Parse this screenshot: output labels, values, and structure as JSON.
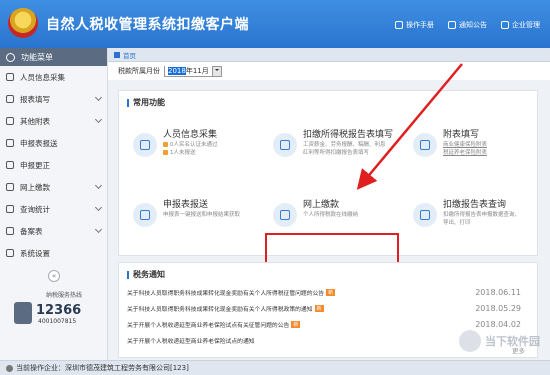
{
  "app": {
    "title": "自然人税收管理系统扣缴客户端",
    "top_links": [
      "操作手册",
      "通知公告",
      "企业管理"
    ]
  },
  "sidebar": {
    "header": "功能菜单",
    "items": [
      {
        "label": "人员信息采集",
        "icon": "person-icon",
        "expandable": false
      },
      {
        "label": "报表填写",
        "icon": "form-icon",
        "expandable": true
      },
      {
        "label": "其他附表",
        "icon": "grid-icon",
        "expandable": true
      },
      {
        "label": "申报表报送",
        "icon": "upload-icon",
        "expandable": false
      },
      {
        "label": "申报更正",
        "icon": "edit-icon",
        "expandable": false
      },
      {
        "label": "网上缴款",
        "icon": "payment-icon",
        "expandable": true
      },
      {
        "label": "查询统计",
        "icon": "search-icon",
        "expandable": true
      },
      {
        "label": "备案表",
        "icon": "folder-icon",
        "expandable": true
      },
      {
        "label": "系统设置",
        "icon": "gear-icon",
        "expandable": false
      }
    ],
    "collapse_symbol": "«",
    "hotline": {
      "label": "纳税服务热线",
      "number": "12366",
      "sub": "4001007815"
    }
  },
  "main": {
    "breadcrumb": "首页",
    "period_label": "税款所属月份",
    "period_year": "2018",
    "period_month": "年11月",
    "common_title": "常用功能",
    "cards": [
      {
        "title": "人员信息采集",
        "desc1": "0人实名认证未通过",
        "desc2": "1人未报送",
        "icon": "person-card-icon"
      },
      {
        "title": "扣缴所得税报告表填写",
        "desc1": "工资薪金、劳务报酬、稿酬、利息",
        "desc2": "红利等所得扣缴报告表填写",
        "icon": "report-icon"
      },
      {
        "title": "附表填写",
        "desc1": "商业健康保险附表",
        "desc2": "税延养老保险附表",
        "icon": "attachment-icon"
      },
      {
        "title": "申报表报送",
        "desc1": "申报表一键报送和申报结果获取",
        "desc2": "",
        "icon": "send-icon"
      },
      {
        "title": "网上缴款",
        "desc1": "个人所得税款在线缴纳",
        "desc2": "",
        "icon": "pay-icon"
      },
      {
        "title": "扣缴报告表查询",
        "desc1": "扣缴所得报告表申报数据查询、",
        "desc2": "导出、打印",
        "icon": "query-icon"
      }
    ],
    "notice_title": "税务通知",
    "notices": [
      {
        "text": "关于科技人员取得职务科技成果转化现金奖励有关个人所得税征管问题的公告",
        "date": "2018.06.11",
        "new": true
      },
      {
        "text": "关于科技人员取得职务科技成果转化现金奖励有关个人所得税政策的通知",
        "date": "2018.05.29",
        "new": true
      },
      {
        "text": "关于开展个人税收递延型商业养老保险试点有关征管问题的公告",
        "date": "2018.04.02",
        "new": true
      },
      {
        "text": "关于开展个人税收递延型商业养老保险试点的通知",
        "date": "",
        "new": false
      }
    ],
    "new_tag": "新",
    "more": "更多"
  },
  "status": {
    "label": "当前操作企业：深圳市德茂建筑工程劳务有限公司[123]"
  },
  "watermark": {
    "text": "当下软件园"
  },
  "colors": {
    "brand": "#2a74cf",
    "highlight": "#e02020",
    "new_tag": "#f28b2d"
  }
}
